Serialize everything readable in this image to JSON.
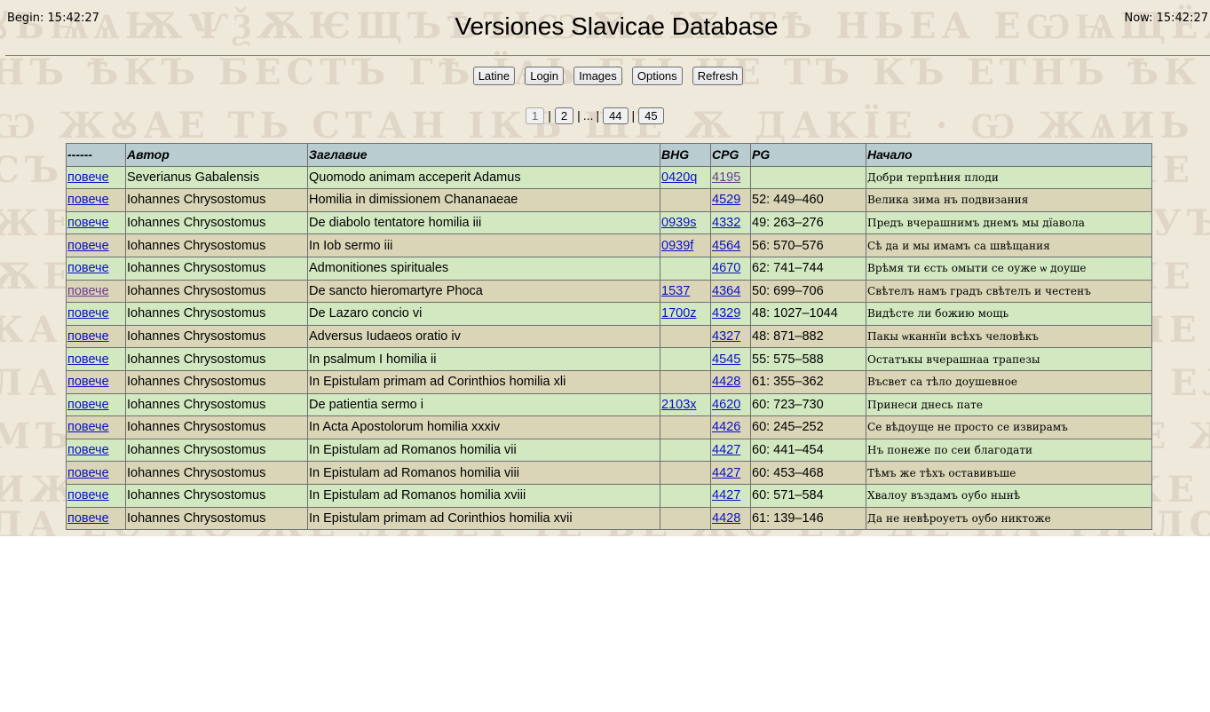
{
  "header": {
    "begin": "Begin: 15:42:27",
    "now": "Now: 15:42:27",
    "title": "Versiones Slavicae Database"
  },
  "buttons": [
    "Latine",
    "Login",
    "Images",
    "Options",
    "Refresh"
  ],
  "pager": {
    "pages": [
      "1",
      "2",
      "...",
      "44",
      "45"
    ],
    "current": "1"
  },
  "table": {
    "headers": [
      "------",
      "Автор",
      "Заглавие",
      "BHG",
      "CPG",
      "PG",
      "Начало"
    ],
    "rows": [
      {
        "more": "повече",
        "author": "Severianus Gabalensis",
        "title": "Quomodo animam acceperit Adamus",
        "bhg": "0420q",
        "cpg": "4195",
        "pg": "",
        "incipit": "Добри терпѣния плоди"
      },
      {
        "more": "повече",
        "author": "Iohannes Chrysostomus",
        "title": "Homilia in dimissionem Chananaeae",
        "bhg": "",
        "cpg": "4529",
        "pg": "52: 449–460",
        "incipit": "Велика зима нъ подвизания"
      },
      {
        "more": "повече",
        "author": "Iohannes Chrysostomus",
        "title": "De diabolo tentatore homilia iii",
        "bhg": "0939s",
        "cpg": "4332",
        "pg": "49: 263–276",
        "incipit": "Предъ вчерашнимъ днемъ мы дїавола"
      },
      {
        "more": "повече",
        "author": "Iohannes Chrysostomus",
        "title": "In Iob sermo iii",
        "bhg": "0939f",
        "cpg": "4564",
        "pg": "56: 570–576",
        "incipit": "Сѣ да и мы имамъ са швѣщания"
      },
      {
        "more": "повече",
        "author": "Iohannes Chrysostomus",
        "title": "Admonitiones spirituales",
        "bhg": "",
        "cpg": "4670",
        "pg": "62: 741–744",
        "incipit": "Врѣмя ти єсть омыти се оуже ѡ доуше"
      },
      {
        "more": "повече",
        "author": "Iohannes Chrysostomus",
        "title": "De sancto hieromartyre Phoca",
        "bhg": "1537",
        "cpg": "4364",
        "pg": "50: 699–706",
        "incipit": "Свѣтелъ намъ градъ свѣтелъ и честенъ"
      },
      {
        "more": "повече",
        "author": "Iohannes Chrysostomus",
        "title": "De Lazaro concio vi",
        "bhg": "1700z",
        "cpg": "4329",
        "pg": "48: 1027–1044",
        "incipit": "Видѣсте ли божию мощь"
      },
      {
        "more": "повече",
        "author": "Iohannes Chrysostomus",
        "title": "Adversus Iudaeos oratio iv",
        "bhg": "",
        "cpg": "4327",
        "pg": "48: 871–882",
        "incipit": "Пакы ѡканнїи всѣхъ человѣкъ"
      },
      {
        "more": "повече",
        "author": "Iohannes Chrysostomus",
        "title": "In psalmum I homilia ii",
        "bhg": "",
        "cpg": "4545",
        "pg": "55: 575–588",
        "incipit": "Остатъкы вчерашнаа трапезы"
      },
      {
        "more": "повече",
        "author": "Iohannes Chrysostomus",
        "title": "In Epistulam primam ad Corinthios homilia xli",
        "bhg": "",
        "cpg": "4428",
        "pg": "61: 355–362",
        "incipit": "Въсвет са тѣло доушевное"
      },
      {
        "more": "повече",
        "author": "Iohannes Chrysostomus",
        "title": "De patientia sermo i",
        "bhg": "2103x",
        "cpg": "4620",
        "pg": "60: 723–730",
        "incipit": "Принеси днесь пате"
      },
      {
        "more": "повече",
        "author": "Iohannes Chrysostomus",
        "title": "In Acta Apostolorum homilia xxxiv",
        "bhg": "",
        "cpg": "4426",
        "pg": "60: 245–252",
        "incipit": "Се вѣдоуще не просто се извирамъ"
      },
      {
        "more": "повече",
        "author": "Iohannes Chrysostomus",
        "title": "In Epistulam ad Romanos homilia vii",
        "bhg": "",
        "cpg": "4427",
        "pg": "60: 441–454",
        "incipit": "Нъ понеже по сеи благодати"
      },
      {
        "more": "повече",
        "author": "Iohannes Chrysostomus",
        "title": "In Epistulam ad Romanos homilia viii",
        "bhg": "",
        "cpg": "4427",
        "pg": "60: 453–468",
        "incipit": "Тѣмъ же тѣхъ оставивъше"
      },
      {
        "more": "повече",
        "author": "Iohannes Chrysostomus",
        "title": "In Epistulam ad Romanos homilia xviii",
        "bhg": "",
        "cpg": "4427",
        "pg": "60: 571–584",
        "incipit": "Хвалоу въздамъ оубо нынѣ"
      },
      {
        "more": "повече",
        "author": "Iohannes Chrysostomus",
        "title": "In Epistulam primam ad Corinthios homilia xvii",
        "bhg": "",
        "cpg": "4428",
        "pg": "61: 139–146",
        "incipit": "Да не невѣроуетъ оубо никтоже"
      }
    ]
  }
}
